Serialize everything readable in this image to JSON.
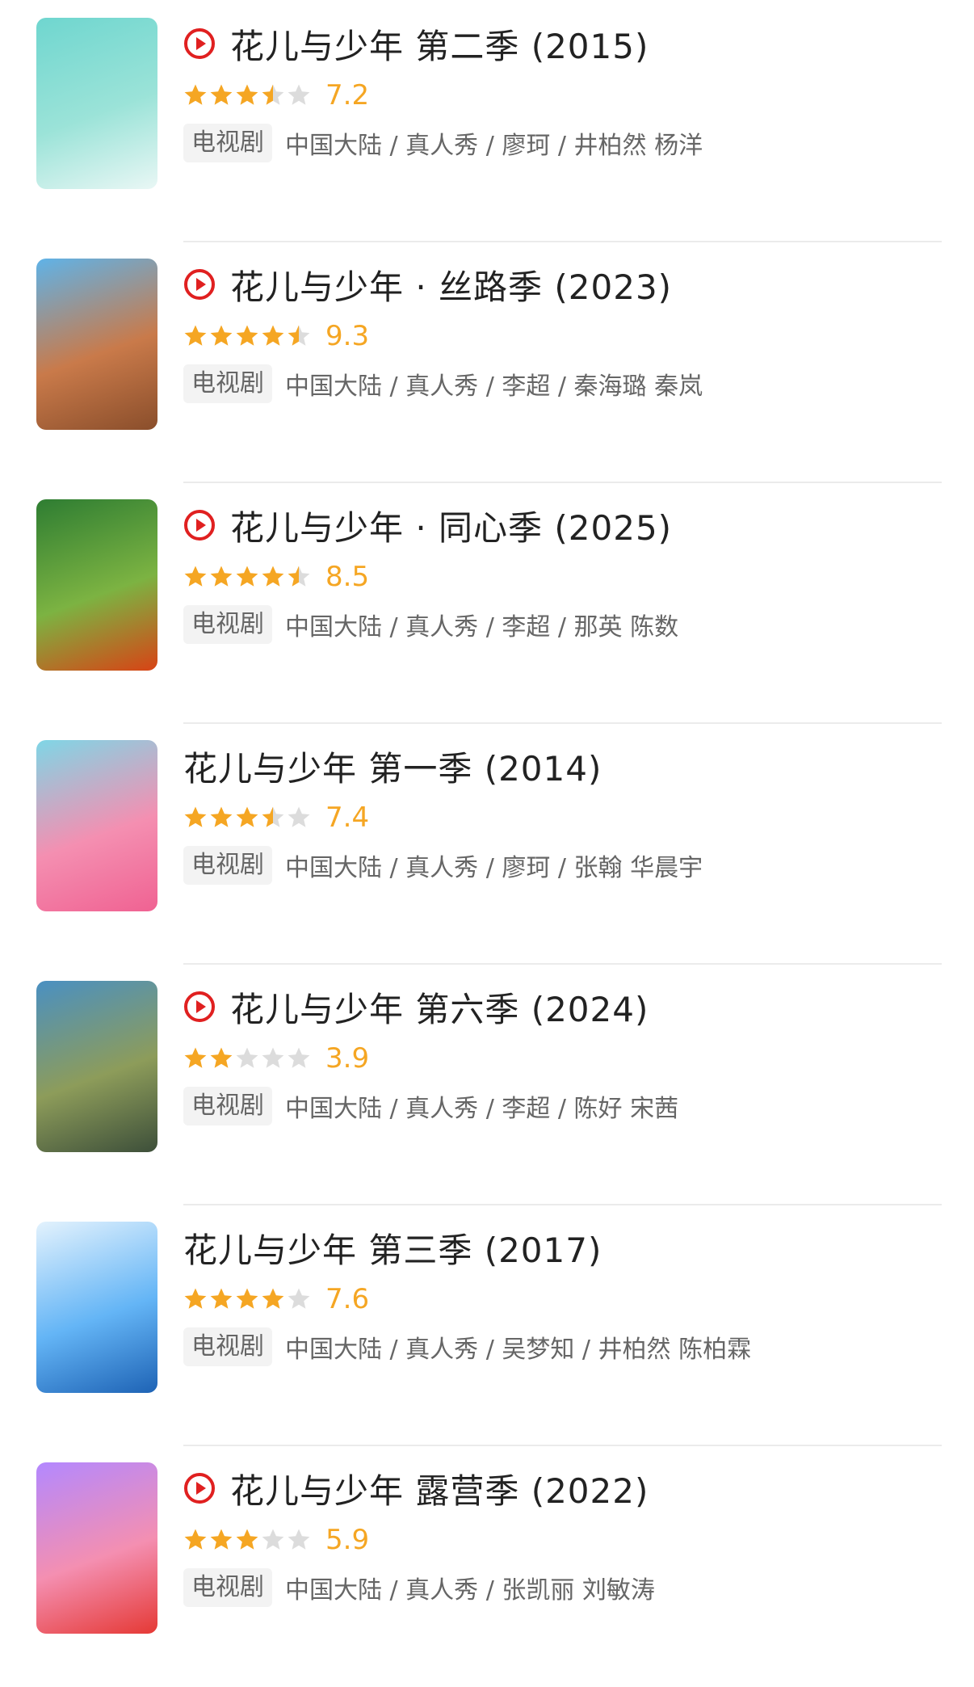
{
  "colors": {
    "star_on": "#f5a623",
    "star_off": "#dcdcdc",
    "play_icon": "#e02020"
  },
  "items": [
    {
      "has_play": true,
      "title": "花儿与少年 第二季 (2015)",
      "score": "7.2",
      "rating_stars": 3.5,
      "type": "电视剧",
      "info": "中国大陆 / 真人秀 / 廖珂 / 井柏然 杨洋",
      "poster_icon": "show-poster-image",
      "poster_colors": [
        "#6fd6cf",
        "#9be3d8",
        "#e9f7f5"
      ],
      "poster_text": ""
    },
    {
      "has_play": true,
      "title": "花儿与少年 · 丝路季 (2023)",
      "score": "9.3",
      "rating_stars": 4.5,
      "type": "电视剧",
      "info": "中国大陆 / 真人秀 / 李超 / 秦海璐 秦岚",
      "poster_icon": "show-poster-image",
      "poster_colors": [
        "#5fb3e8",
        "#c97a4a",
        "#8a4e2b"
      ],
      "poster_text": ""
    },
    {
      "has_play": true,
      "title": "花儿与少年 · 同心季 (2025)",
      "score": "8.5",
      "rating_stars": 4.5,
      "type": "电视剧",
      "info": "中国大陆 / 真人秀 / 李超 / 那英 陈数",
      "poster_icon": "show-poster-image",
      "poster_colors": [
        "#2e7d32",
        "#7cb342",
        "#d84315"
      ],
      "poster_text": ""
    },
    {
      "has_play": false,
      "title": "花儿与少年 第一季 (2014)",
      "score": "7.4",
      "rating_stars": 3.5,
      "type": "电视剧",
      "info": "中国大陆 / 真人秀 / 廖珂 / 张翰 华晨宇",
      "poster_icon": "show-poster-image",
      "poster_colors": [
        "#7fd6e6",
        "#f48fb1",
        "#f06292"
      ],
      "poster_text": ""
    },
    {
      "has_play": true,
      "title": "花儿与少年 第六季 (2024)",
      "score": "3.9",
      "rating_stars": 2,
      "type": "电视剧",
      "info": "中国大陆 / 真人秀 / 李超 / 陈好 宋茜",
      "poster_icon": "show-poster-image",
      "poster_colors": [
        "#4a90c2",
        "#8d9c5a",
        "#3d4f3a"
      ],
      "poster_text": ""
    },
    {
      "has_play": false,
      "title": "花儿与少年 第三季 (2017)",
      "score": "7.6",
      "rating_stars": 4,
      "type": "电视剧",
      "info": "中国大陆 / 真人秀 / 吴梦知 / 井柏然 陈柏霖",
      "poster_icon": "show-poster-image",
      "poster_colors": [
        "#e3f2fd",
        "#64b5f6",
        "#1e63b5"
      ],
      "poster_text": ""
    },
    {
      "has_play": true,
      "title": "花儿与少年 露营季 (2022)",
      "score": "5.9",
      "rating_stars": 3,
      "type": "电视剧",
      "info": "中国大陆 / 真人秀 / 张凯丽 刘敏涛",
      "poster_icon": "show-poster-image",
      "poster_colors": [
        "#b388ff",
        "#f48fb1",
        "#e53935"
      ],
      "poster_text": ""
    }
  ]
}
